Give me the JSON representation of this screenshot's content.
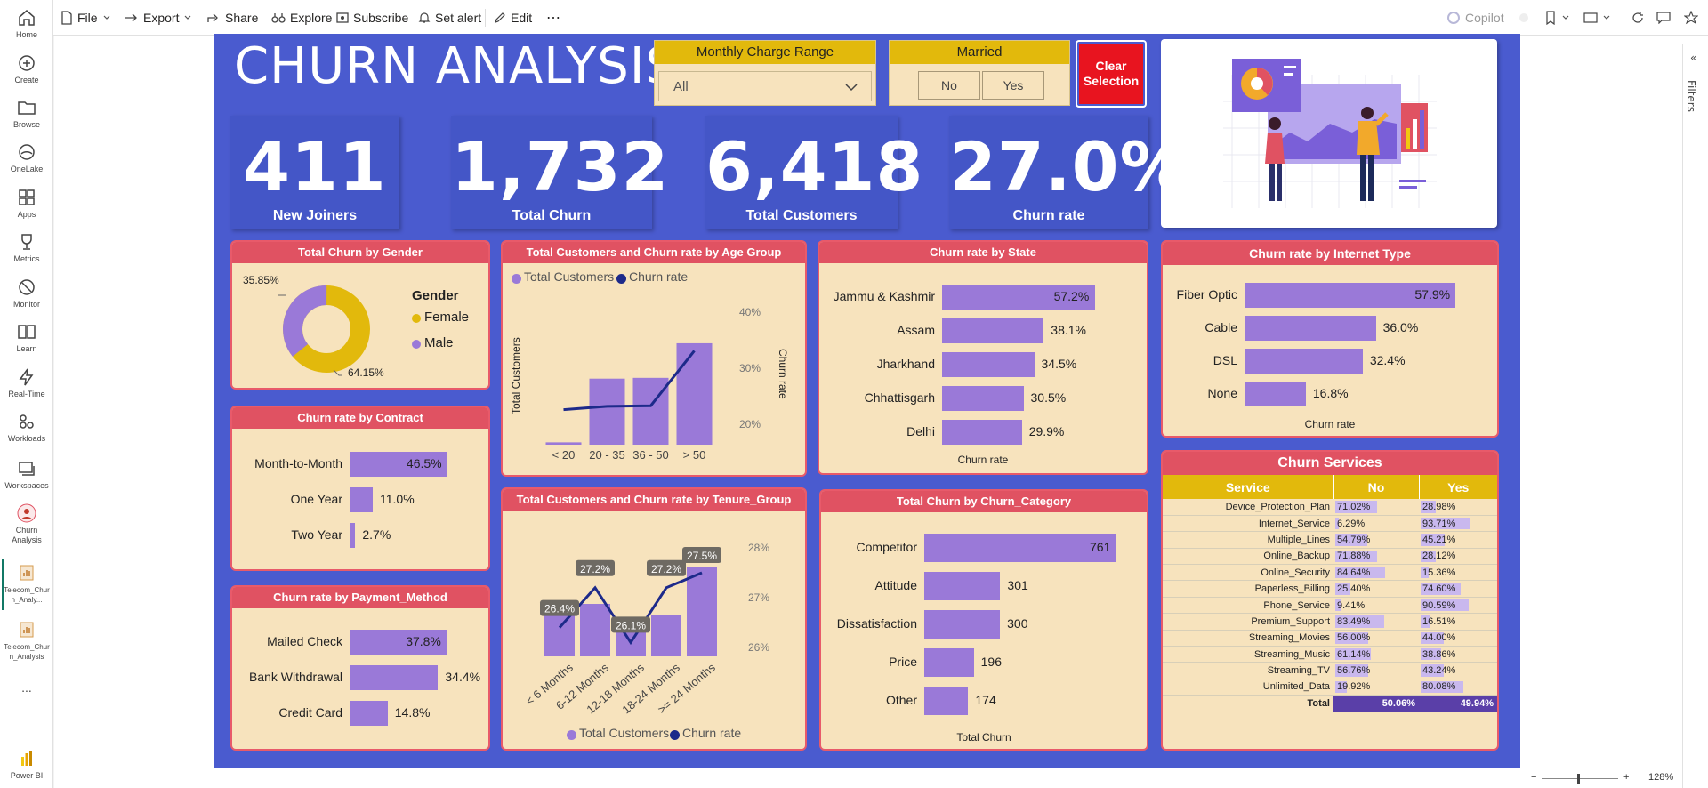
{
  "toolbar": {
    "file": "File",
    "export": "Export",
    "share": "Share",
    "explore": "Explore",
    "subscribe": "Subscribe",
    "set_alert": "Set alert",
    "edit": "Edit",
    "copilot": "Copilot"
  },
  "nav": {
    "items": [
      "Home",
      "Create",
      "Browse",
      "OneLake",
      "Apps",
      "Metrics",
      "Monitor",
      "Learn",
      "Real-Time",
      "Workloads",
      "Workspaces"
    ],
    "churn_analysis": "Churn Analysis",
    "report1": "Telecom_Churn_Analy...",
    "report2": "Telecom_Churn_Analysis",
    "more": "...",
    "powerbi": "Power BI"
  },
  "filters_label": "Filters",
  "zoom": "128%",
  "report": {
    "title": "CHURN ANALYSIS",
    "slicer_charge": {
      "title": "Monthly Charge Range",
      "value": "All"
    },
    "slicer_married": {
      "title": "Married",
      "no": "No",
      "yes": "Yes"
    },
    "clear": "Clear Selection",
    "kpis": [
      {
        "value": "411",
        "label": "New Joiners"
      },
      {
        "value": "1,732",
        "label": "Total Churn"
      },
      {
        "value": "6,418",
        "label": "Total Customers"
      },
      {
        "value": "27.0%",
        "label": "Churn rate"
      }
    ]
  },
  "gender": {
    "title": "Total Churn by Gender",
    "legend_title": "Gender",
    "female": "Female",
    "male": "Male",
    "male_pct": "35.85%",
    "female_pct": "64.15%",
    "male_value": 35.85,
    "female_value": 64.15,
    "colors": {
      "female": "#e2b90c",
      "male": "#9a79d8"
    }
  },
  "age": {
    "title": "Total Customers and Churn rate by Age Group",
    "legend": [
      "Total Customers",
      "Churn rate"
    ],
    "ylabel": "Total Customers",
    "y2label": "Churn rate",
    "categories": [
      "< 20",
      "20 - 35",
      "36 - 50",
      "> 50"
    ],
    "customers": [
      60,
      1700,
      1720,
      2610
    ],
    "churn_rate": [
      22.6,
      23.2,
      23.3,
      33.1
    ],
    "y2ticks": [
      "40%",
      "30%",
      "20%"
    ]
  },
  "state": {
    "title": "Churn rate by State",
    "xlabel": "Churn rate",
    "items": [
      {
        "label": "Jammu & Kashmir",
        "value": 57.2,
        "text": "57.2%"
      },
      {
        "label": "Assam",
        "value": 38.1,
        "text": "38.1%"
      },
      {
        "label": "Jharkhand",
        "value": 34.5,
        "text": "34.5%"
      },
      {
        "label": "Chhattisgarh",
        "value": 30.5,
        "text": "30.5%"
      },
      {
        "label": "Delhi",
        "value": 29.9,
        "text": "29.9%"
      }
    ]
  },
  "internet": {
    "title": "Churn rate by Internet Type",
    "xlabel": "Churn rate",
    "items": [
      {
        "label": "Fiber Optic",
        "value": 57.9,
        "text": "57.9%"
      },
      {
        "label": "Cable",
        "value": 36.0,
        "text": "36.0%"
      },
      {
        "label": "DSL",
        "value": 32.4,
        "text": "32.4%"
      },
      {
        "label": "None",
        "value": 16.8,
        "text": "16.8%"
      }
    ]
  },
  "contract": {
    "title": "Churn rate by Contract",
    "items": [
      {
        "label": "Month-to-Month",
        "value": 46.5,
        "text": "46.5%"
      },
      {
        "label": "One Year",
        "value": 11.0,
        "text": "11.0%"
      },
      {
        "label": "Two Year",
        "value": 2.7,
        "text": "2.7%"
      }
    ]
  },
  "payment": {
    "title": "Churn rate by Payment_Method",
    "items": [
      {
        "label": "Mailed Check",
        "value": 37.8,
        "text": "37.8%"
      },
      {
        "label": "Bank Withdrawal",
        "value": 34.4,
        "text": "34.4%"
      },
      {
        "label": "Credit Card",
        "value": 14.8,
        "text": "14.8%"
      }
    ]
  },
  "tenure": {
    "title": "Total Customers and Churn rate by Tenure_Group",
    "legend": [
      "Total Customers",
      "Churn rate"
    ],
    "categories": [
      "< 6 Months",
      "6-12 Months",
      "12-18 Months",
      "18-24 Months",
      ">= 24 Months"
    ],
    "customers": [
      1030,
      1280,
      965,
      1005,
      2190
    ],
    "churn_rate": [
      26.4,
      27.2,
      26.1,
      27.2,
      27.5
    ],
    "labels": [
      "26.4%",
      "27.2%",
      "26.1%",
      "27.2%",
      "27.5%"
    ],
    "y2ticks": [
      "28%",
      "27%",
      "26%"
    ]
  },
  "category": {
    "title": "Total Churn by Churn_Category",
    "xlabel": "Total Churn",
    "items": [
      {
        "label": "Competitor",
        "value": 761,
        "text": "761"
      },
      {
        "label": "Attitude",
        "value": 301,
        "text": "301"
      },
      {
        "label": "Dissatisfaction",
        "value": 300,
        "text": "300"
      },
      {
        "label": "Price",
        "value": 196,
        "text": "196"
      },
      {
        "label": "Other",
        "value": 174,
        "text": "174"
      }
    ]
  },
  "services": {
    "title": "Churn Services",
    "headers": [
      "Service",
      "No",
      "Yes"
    ],
    "rows": [
      {
        "service": "Device_Protection_Plan",
        "no": "71.02%",
        "yes": "28.98%",
        "nv": 71.02,
        "yv": 28.98
      },
      {
        "service": "Internet_Service",
        "no": "6.29%",
        "yes": "93.71%",
        "nv": 6.29,
        "yv": 93.71
      },
      {
        "service": "Multiple_Lines",
        "no": "54.79%",
        "yes": "45.21%",
        "nv": 54.79,
        "yv": 45.21
      },
      {
        "service": "Online_Backup",
        "no": "71.88%",
        "yes": "28.12%",
        "nv": 71.88,
        "yv": 28.12
      },
      {
        "service": "Online_Security",
        "no": "84.64%",
        "yes": "15.36%",
        "nv": 84.64,
        "yv": 15.36
      },
      {
        "service": "Paperless_Billing",
        "no": "25.40%",
        "yes": "74.60%",
        "nv": 25.4,
        "yv": 74.6
      },
      {
        "service": "Phone_Service",
        "no": "9.41%",
        "yes": "90.59%",
        "nv": 9.41,
        "yv": 90.59
      },
      {
        "service": "Premium_Support",
        "no": "83.49%",
        "yes": "16.51%",
        "nv": 83.49,
        "yv": 16.51
      },
      {
        "service": "Streaming_Movies",
        "no": "56.00%",
        "yes": "44.00%",
        "nv": 56.0,
        "yv": 44.0
      },
      {
        "service": "Streaming_Music",
        "no": "61.14%",
        "yes": "38.86%",
        "nv": 61.14,
        "yv": 38.86
      },
      {
        "service": "Streaming_TV",
        "no": "56.76%",
        "yes": "43.24%",
        "nv": 56.76,
        "yv": 43.24
      },
      {
        "service": "Unlimited_Data",
        "no": "19.92%",
        "yes": "80.08%",
        "nv": 19.92,
        "yv": 80.08
      }
    ],
    "total": {
      "label": "Total",
      "no": "50.06%",
      "yes": "49.94%"
    }
  }
}
